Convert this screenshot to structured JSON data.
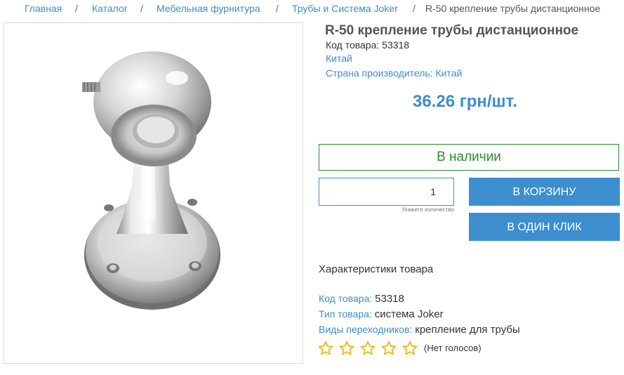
{
  "breadcrumb": {
    "items": [
      "Главная",
      "Каталог",
      "Мебельная фурнитура",
      "Трубы и Система Joker",
      "R-50 крепление трубы дистанционное"
    ],
    "separator": "/"
  },
  "product": {
    "title": "R-50 крепление трубы дистанционное",
    "code_line": "Код товара: 53318",
    "brand": "Китай",
    "country_line": "Страна производитель: Китай",
    "price": "36.26 грн/шт.",
    "availability": "В наличии",
    "quantity_value": "1",
    "quantity_hint": "Укажите количество",
    "cart_button": "В КОРЗИНУ",
    "one_click_button": "В ОДИН КЛИК"
  },
  "specs": {
    "title": "Характеристики товара",
    "rows": [
      {
        "key": "Код товара:",
        "value": "53318"
      },
      {
        "key": "Тип товара:",
        "value": "система Joker"
      },
      {
        "key": "Виды переходников:",
        "value": "крепление для трубы"
      }
    ]
  },
  "rating": {
    "stars_total": 5,
    "stars_filled": 0,
    "votes_label": "(Нет голосов)"
  },
  "colors": {
    "accent": "#3c8ecf",
    "in_stock": "#2e8b2e",
    "star": "#e8b400"
  }
}
